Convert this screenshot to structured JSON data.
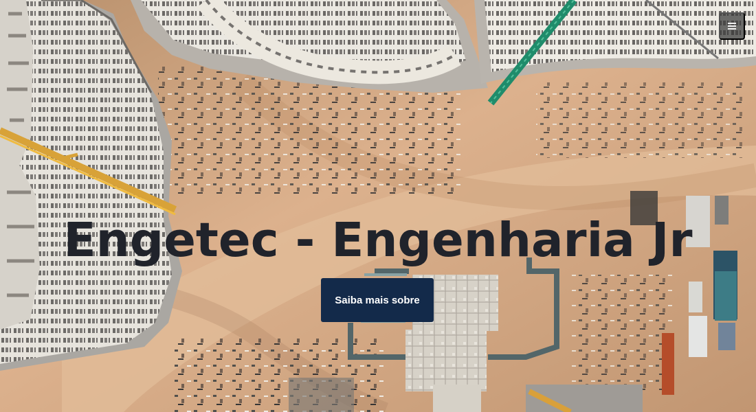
{
  "hero": {
    "title": "Engetec - Engenharia Jr",
    "cta_label": "Saiba mais sobre",
    "menu_icon": "hamburger-menu-icon"
  },
  "colors": {
    "title": "#20232b",
    "button_background": "#132a4a",
    "button_text": "#ffffff",
    "menu_background": "#373737",
    "ground": "#c9a17d"
  }
}
